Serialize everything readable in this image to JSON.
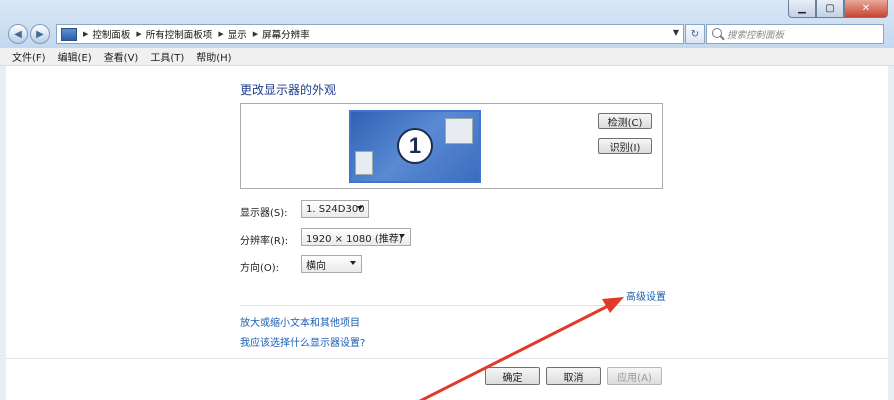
{
  "breadcrumb": [
    "控制面板",
    "所有控制面板项",
    "显示",
    "屏幕分辨率"
  ],
  "search": {
    "placeholder": "搜索控制面板"
  },
  "menu": [
    "文件(F)",
    "编辑(E)",
    "查看(V)",
    "工具(T)",
    "帮助(H)"
  ],
  "page": {
    "title": "更改显示器的外观"
  },
  "monitor": {
    "number": "1"
  },
  "buttons": {
    "detect": "检测(C)",
    "identify": "识别(I)",
    "ok": "确定",
    "cancel": "取消",
    "apply": "应用(A)"
  },
  "fields": {
    "display": {
      "label": "显示器(S):",
      "value": "1. S24D300"
    },
    "resolution": {
      "label": "分辨率(R):",
      "value": "1920 × 1080 (推荐)"
    },
    "orientation": {
      "label": "方向(O):",
      "value": "横向"
    }
  },
  "links": {
    "advanced": "高级设置",
    "text_size": "放大或缩小文本和其他项目",
    "which_settings": "我应该选择什么显示器设置?"
  },
  "colors": {
    "link": "#1a5fb4",
    "arrow": "#e23a2a",
    "monitor_fill": "#3b6cc0"
  }
}
